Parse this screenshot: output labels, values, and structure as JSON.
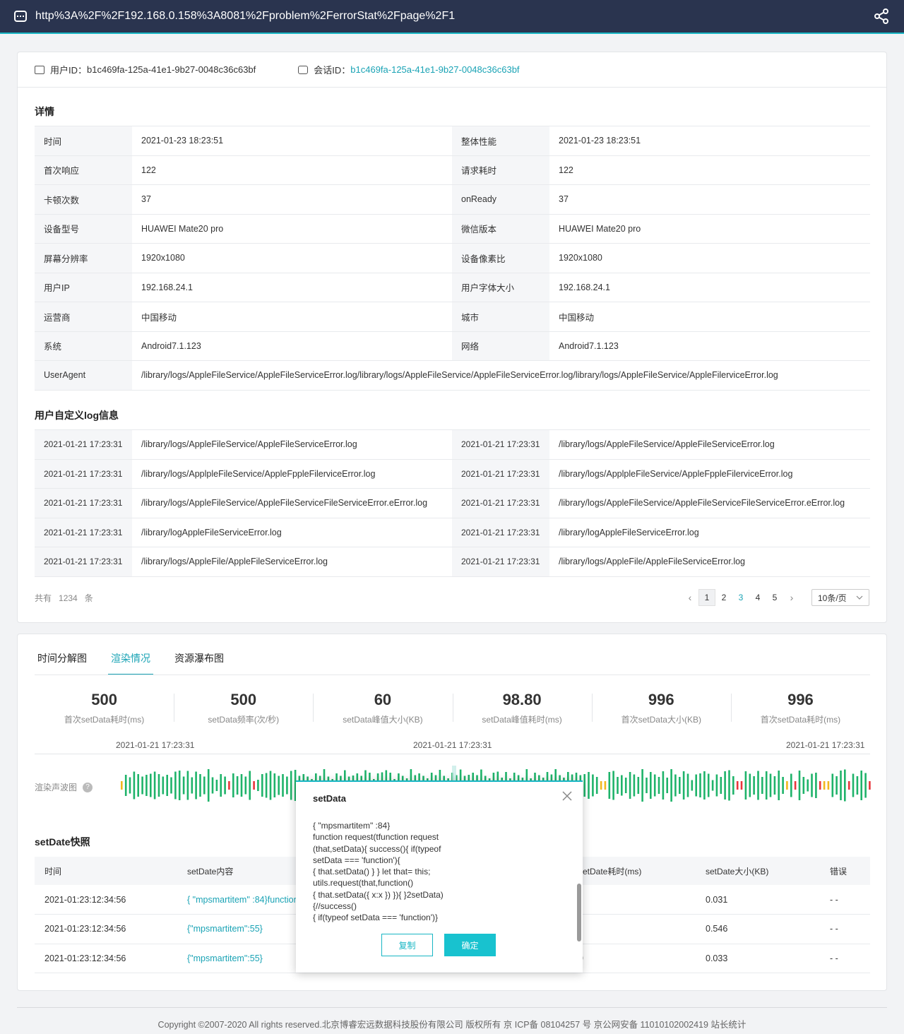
{
  "topbar": {
    "url": "http%3A%2F%2F192.168.0.158%3A8081%2Fproblem%2FerrorStat%2Fpage%2F1"
  },
  "ids": {
    "user_label": "用户ID：",
    "user_value": "b1c469fa-125a-41e1-9b27-0048c36c63bf",
    "session_label": "会话ID：",
    "session_value": "b1c469fa-125a-41e1-9b27-0048c36c63bf"
  },
  "details": {
    "title": "详情",
    "rows": [
      {
        "k1": "时间",
        "v1": "2021-01-23  18:23:51",
        "k2": "整体性能",
        "v2": "2021-01-23  18:23:51"
      },
      {
        "k1": "首次响应",
        "v1": "122",
        "k2": "请求耗时",
        "v2": "122"
      },
      {
        "k1": "卡顿次数",
        "v1": "37",
        "k2": "onReady",
        "v2": "37"
      },
      {
        "k1": "设备型号",
        "v1": "HUAWEI Mate20 pro",
        "k2": "微信版本",
        "v2": "HUAWEI Mate20 pro"
      },
      {
        "k1": "屏幕分辨率",
        "v1": "1920x1080",
        "k2": "设备像素比",
        "v2": "1920x1080"
      },
      {
        "k1": "用户IP",
        "v1": "192.168.24.1",
        "k2": "用户字体大小",
        "v2": "192.168.24.1"
      },
      {
        "k1": "运营商",
        "v1": "中国移动",
        "k2": "城市",
        "v2": "中国移动"
      },
      {
        "k1": "系统",
        "v1": "Android7.1.123",
        "k2": "网络",
        "v2": "Android7.1.123"
      }
    ],
    "ua_label": "UserAgent",
    "ua_value": "/library/logs/AppleFileService/AppleFileServiceError.log/library/logs/AppleFileService/AppleFileServiceError.log/library/logs/AppleFileService/AppleFilerviceError.log"
  },
  "custom_log": {
    "title": "用户自定义log信息",
    "rows": [
      {
        "t1": "2021-01-21  17:23:31",
        "l1": "/library/logs/AppleFileService/AppleFileServiceError.log",
        "t2": "2021-01-21  17:23:31",
        "l2": "/library/logs/AppleFileService/AppleFileServiceError.log"
      },
      {
        "t1": "2021-01-21  17:23:31",
        "l1": "/library/logs/ApplpleFileService/AppleFppleFilerviceError.log",
        "t2": "2021-01-21  17:23:31",
        "l2": "/library/logs/ApplpleFileService/AppleFppleFilerviceError.log"
      },
      {
        "t1": "2021-01-21  17:23:31",
        "l1": "/library/logs/AppleFileService/AppleFileServiceFileServiceError.eError.log",
        "t2": "2021-01-21  17:23:31",
        "l2": "/library/logs/AppleFileService/AppleFileServiceFileServiceError.eError.log"
      },
      {
        "t1": "2021-01-21  17:23:31",
        "l1": "/library/logAppleFileServiceError.log",
        "t2": "2021-01-21  17:23:31",
        "l2": "/library/logAppleFileServiceError.log"
      },
      {
        "t1": "2021-01-21  17:23:31",
        "l1": "/library/logs/AppleFile/AppleFileServiceError.log",
        "t2": "2021-01-21  17:23:31",
        "l2": "/library/logs/AppleFile/AppleFileServiceError.log"
      }
    ]
  },
  "pager": {
    "total_prefix": "共有",
    "total": "1234",
    "total_suffix": "条",
    "pages": [
      "1",
      "2",
      "3",
      "4",
      "5"
    ],
    "prev": "‹",
    "next": "›",
    "page_size": "10条/页"
  },
  "tabs": [
    "时间分解图",
    "渲染情况",
    "资源瀑布图"
  ],
  "stats": [
    {
      "num": "500",
      "label": "首次setData耗时(ms)"
    },
    {
      "num": "500",
      "label": "setData频率(次/秒)"
    },
    {
      "num": "60",
      "label": "setData峰值大小(KB)"
    },
    {
      "num": "98.80",
      "label": "setData峰值耗时(ms)"
    },
    {
      "num": "996",
      "label": "首次setData大小(KB)"
    },
    {
      "num": "996",
      "label": "首次setData耗时(ms)"
    }
  ],
  "timeline": [
    "2021-01-21  17:23:31",
    "2021-01-21  17:23:31",
    "2021-01-21  17:23:31"
  ],
  "wave": {
    "label": "渲染声波图",
    "colors": {
      "ok": "#1fb36a",
      "warn": "#f2b81f",
      "error": "#e8363b"
    }
  },
  "snapshot": {
    "title": "setDate快照",
    "headers": [
      "时间",
      "setDate内容",
      "",
      "setDate耗时(ms)",
      "setDate大小(KB)",
      "错误"
    ],
    "rows": [
      {
        "time": "2021-01:23:12:34:56",
        "content": "{ \"mpsmartitem\" :84}function request",
        "cost": "",
        "size": "0.031",
        "err": "- -"
      },
      {
        "time": "2021-01:23:12:34:56",
        "content": "{\"mpsmartitem\":55}",
        "cost": "",
        "size": "0.546",
        "err": "- -"
      },
      {
        "time": "2021-01:23:12:34:56",
        "content": "{\"mpsmartitem\":55}",
        "cost": "9",
        "size": "0.033",
        "err": "- -"
      }
    ]
  },
  "modal": {
    "title": "setData",
    "code": [
      "{ \"mpsmartitem\" :84}",
      "function request(tfunction request",
      "(that,setData){ success(){ if(typeof",
      "setData === 'function'){",
      "{ that.setData() } } let that= this;",
      "utils.request(that,function()",
      "{ that.setData({ x:x }) }){ }2setData)",
      "{//success()",
      "{ if(typeof setData === 'function')}"
    ],
    "copy": "复制",
    "ok": "确定"
  },
  "footer": "Copyright ©2007-2020 All rights reserved.北京博睿宏远数据科技股份有限公司 版权所有 京 ICP备 08104257 号 京公网安备 11010102002419 站长统计"
}
